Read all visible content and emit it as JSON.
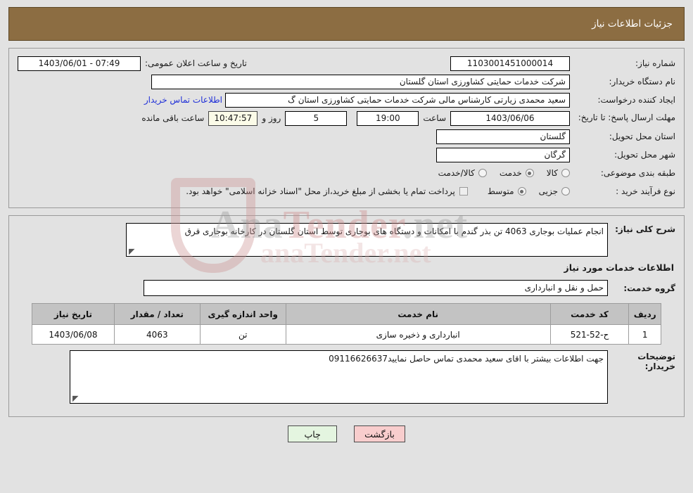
{
  "header": {
    "title": "جزئیات اطلاعات نیاز"
  },
  "watermark": {
    "brand_left": "Ana",
    "brand_mid": "Tender",
    "brand_right": ".net",
    "top_text": "anaTender.net"
  },
  "info": {
    "need_number_label": "شماره نیاز:",
    "need_number_value": "1103001451000014",
    "announce_label": "تاریخ و ساعت اعلان عمومی:",
    "announce_value": "1403/06/01 - 07:49",
    "buyer_org_label": "نام دستگاه خریدار:",
    "buyer_org_value": "شرکت خدمات حمایتی کشاورزی استان گلستان",
    "creator_label": "ایجاد کننده درخواست:",
    "creator_value": "سعید محمدی زیارتی کارشناس مالی شرکت خدمات حمایتی کشاورزی استان گ",
    "buyer_contact_link": "اطلاعات تماس خریدار",
    "deadline_label": "مهلت ارسال پاسخ: تا تاریخ:",
    "deadline_date": "1403/06/06",
    "deadline_hour_label": "ساعت",
    "deadline_hour_value": "19:00",
    "remaining_days": "5",
    "days_and_label": "روز و",
    "remaining_time": "10:47:57",
    "remaining_suffix": "ساعت باقی مانده",
    "province_label": "استان محل تحویل:",
    "province_value": "گلستان",
    "city_label": "شهر محل تحویل:",
    "city_value": "گرگان",
    "category_label": "طبقه بندی موضوعی:",
    "category_options": [
      {
        "label": "کالا",
        "selected": false
      },
      {
        "label": "خدمت",
        "selected": true
      },
      {
        "label": "کالا/خدمت",
        "selected": false
      }
    ],
    "process_label": "نوع فرآیند خرید :",
    "process_options": [
      {
        "label": "جزیی",
        "selected": false
      },
      {
        "label": "متوسط",
        "selected": true
      }
    ],
    "treasury_checkbox_text": "پرداخت تمام یا بخشی از مبلغ خرید،از محل \"اسناد خزانه اسلامی\" خواهد بود.",
    "treasury_checked": false
  },
  "details": {
    "summary_label": "شرح کلی نیاز:",
    "summary_value": "انجام عملیات بوجاری 4063 تن بذر گندم با امکانات و دستگاه های بوجاری توسط استان گلستان در کارخانه بوجاری قرق",
    "services_section_title": "اطلاعات خدمات مورد نیاز",
    "service_group_label": "گروه خدمت:",
    "service_group_value": "حمل و نقل و انبارداری",
    "table": {
      "headers": [
        "ردیف",
        "کد خدمت",
        "نام خدمت",
        "واحد اندازه گیری",
        "تعداد / مقدار",
        "تاریخ نیاز"
      ],
      "rows": [
        {
          "radif": "1",
          "code": "ح-52-521",
          "name": "انبارداری و ذخیره سازی",
          "unit": "تن",
          "qty": "4063",
          "date": "1403/06/08"
        }
      ]
    },
    "buyer_notes_label": "توضیحات خریدار:",
    "buyer_notes_value": "جهت اطلاعات بیشتر با اقای سعید محمدی تماس حاصل نمایید09116626637"
  },
  "footer": {
    "back_label": "بازگشت",
    "print_label": "چاپ"
  }
}
